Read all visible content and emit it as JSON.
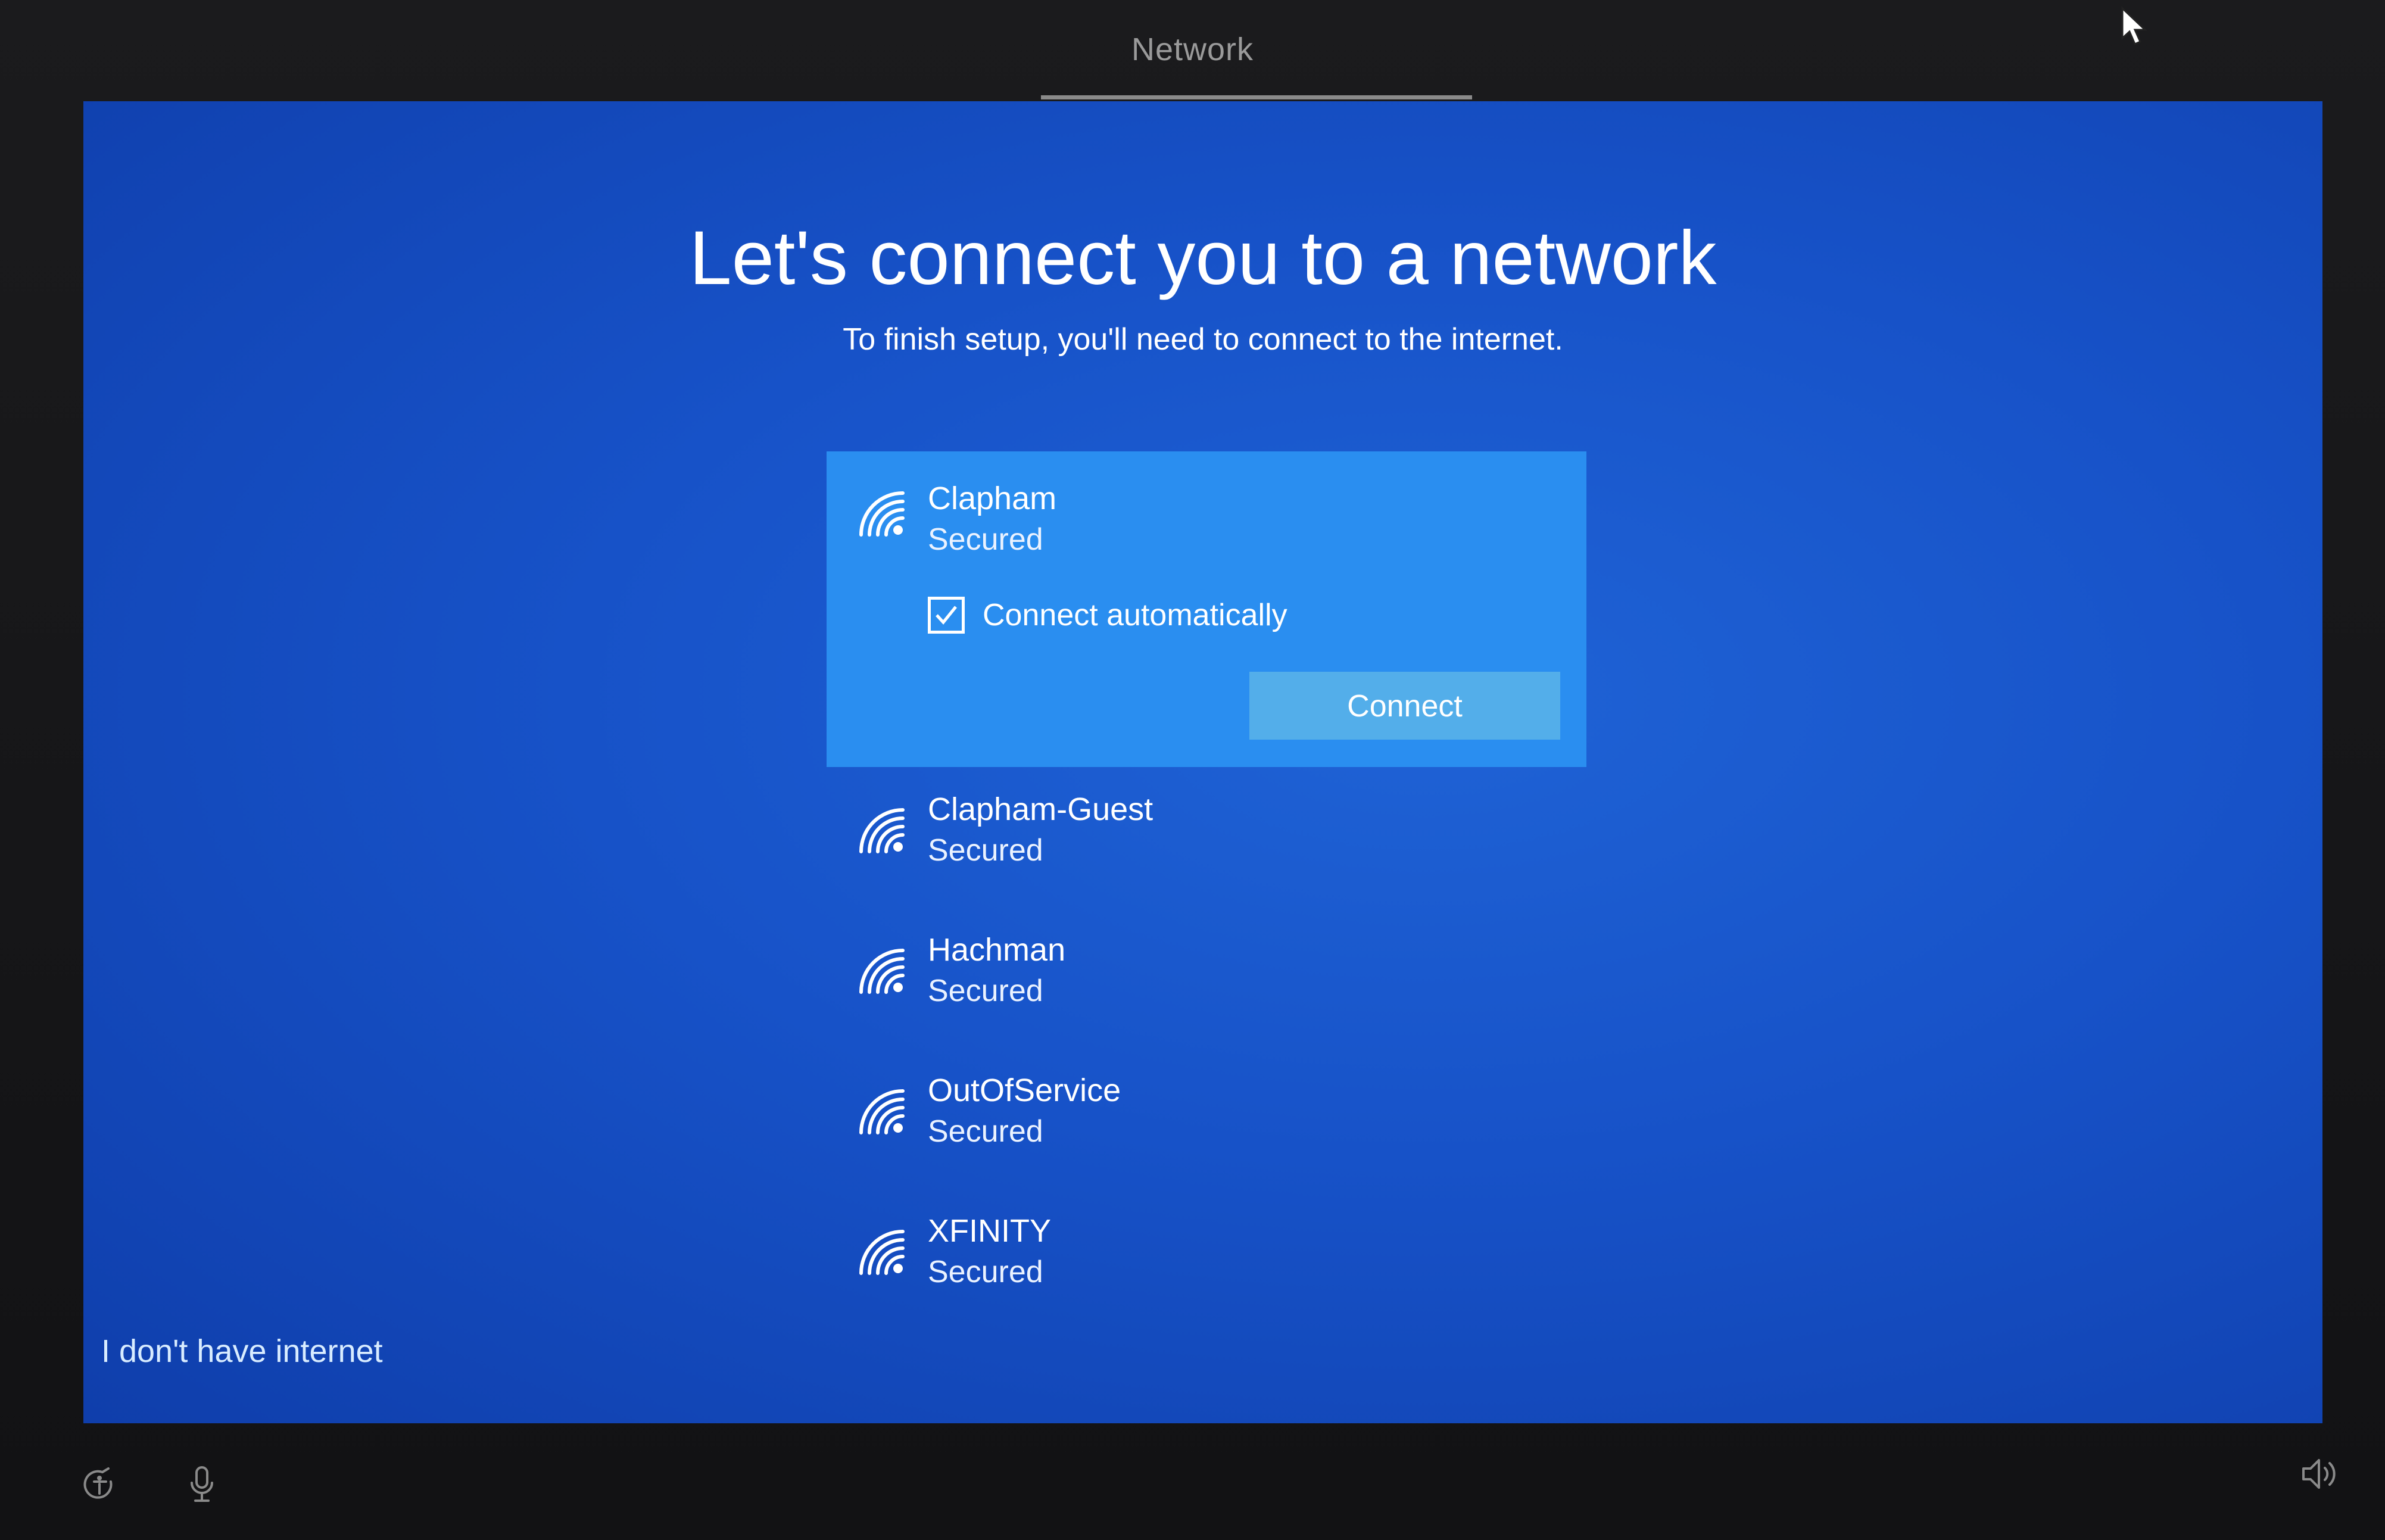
{
  "window": {
    "title": "Network"
  },
  "page": {
    "heading": "Let's connect you to a network",
    "subheading": "To finish setup, you'll need to connect to the internet."
  },
  "networks": [
    {
      "name": "Clapham",
      "status": "Secured",
      "selected": true
    },
    {
      "name": "Clapham-Guest",
      "status": "Secured"
    },
    {
      "name": "Hachman",
      "status": "Secured"
    },
    {
      "name": "OutOfService",
      "status": "Secured"
    },
    {
      "name": "XFINITY",
      "status": "Secured"
    }
  ],
  "selected_network": {
    "connect_automatically_label": "Connect automatically",
    "connect_automatically_checked": true,
    "connect_button_label": "Connect"
  },
  "footer": {
    "no_internet_link": "I don't have internet"
  },
  "icons": {
    "network": "wifi-icon",
    "checkbox": "checkmark-icon",
    "cursor": "mouse-pointer-icon",
    "ease_of_access": "ease-of-access-icon",
    "microphone": "microphone-icon",
    "volume": "volume-icon"
  },
  "colors": {
    "background_blue": "#1752c8",
    "selected_item": "#2a8ef0",
    "connect_button": "#53aeea",
    "link": "#d8ecff"
  }
}
